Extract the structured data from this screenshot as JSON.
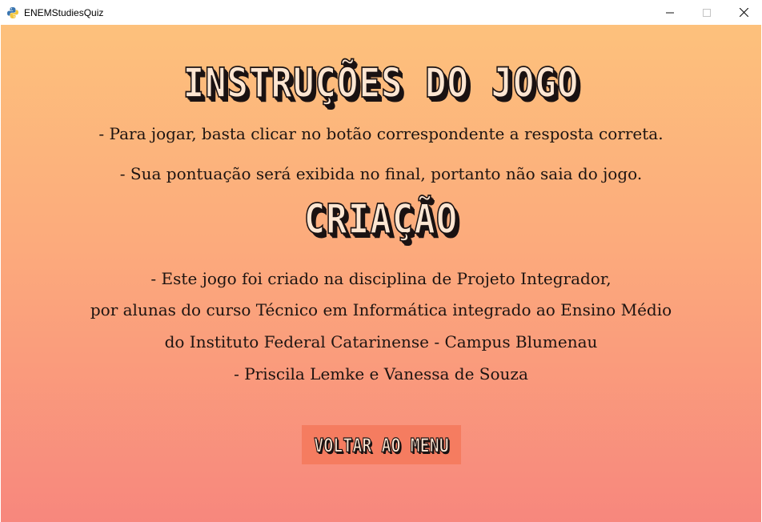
{
  "window": {
    "title": "ENEMStudiesQuiz",
    "icon": "python-icon",
    "controls": {
      "minimize": "—",
      "maximize": "☐",
      "close": "✕"
    }
  },
  "instructions": {
    "heading": "INSTRUÇÕES DO JOGO",
    "lines": [
      "- Para jogar, basta clicar no botão correspondente a resposta correta.",
      "- Sua pontuação será exibida no final, portanto não saia do jogo."
    ]
  },
  "credits": {
    "heading": "CRIAÇÃO",
    "lines": [
      "- Este jogo foi criado na disciplina de Projeto Integrador,",
      "por alunas do curso Técnico em Informática integrado ao Ensino Médio",
      "do Instituto Federal Catarinense - Campus Blumenau",
      "- Priscila Lemke e Vanessa de Souza"
    ]
  },
  "menu_button": {
    "label": "VOLTAR AO MENU"
  },
  "colors": {
    "gradient_top": "#fdc17c",
    "gradient_bottom": "#f7877d",
    "button_bg": "#f57c60",
    "heading_fill": "#fde6d2",
    "heading_outline": "#1a1212",
    "body_text": "#1d1411"
  }
}
